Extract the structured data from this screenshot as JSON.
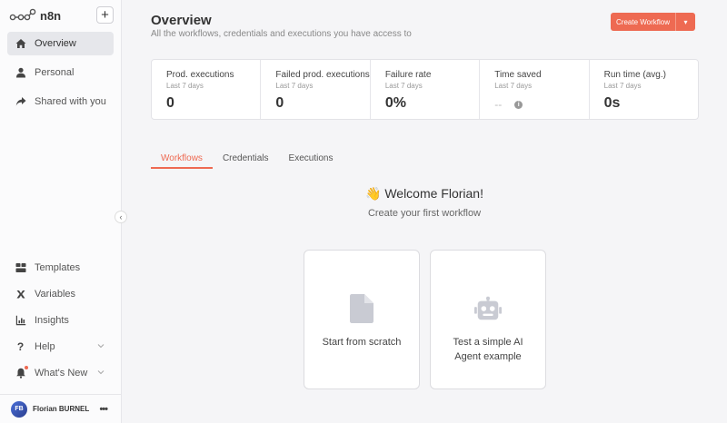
{
  "app": {
    "name": "n8n"
  },
  "sidebar": {
    "add_label": "+",
    "items": [
      {
        "label": "Overview",
        "icon": "home-icon"
      },
      {
        "label": "Personal",
        "icon": "user-icon"
      },
      {
        "label": "Shared with you",
        "icon": "share-icon"
      }
    ],
    "bottom_items": [
      {
        "label": "Templates",
        "icon": "templates-icon"
      },
      {
        "label": "Variables",
        "icon": "variables-icon"
      },
      {
        "label": "Insights",
        "icon": "insights-icon"
      },
      {
        "label": "Help",
        "icon": "help-icon"
      },
      {
        "label": "What's New",
        "icon": "bell-icon"
      }
    ],
    "user": {
      "initials": "FB",
      "name": "Florian BURNEL",
      "menu": "•••"
    },
    "collapse": "‹"
  },
  "header": {
    "title": "Overview",
    "subtitle": "All the workflows, credentials and executions you have access to",
    "create_label": "Create Workflow",
    "create_caret": "▾"
  },
  "stats": [
    {
      "label": "Prod. executions",
      "period": "Last 7 days",
      "value": "0"
    },
    {
      "label": "Failed prod. executions",
      "period": "Last 7 days",
      "value": "0"
    },
    {
      "label": "Failure rate",
      "period": "Last 7 days",
      "value": "0%"
    },
    {
      "label": "Time saved",
      "period": "Last 7 days",
      "value": "--"
    },
    {
      "label": "Run time (avg.)",
      "period": "Last 7 days",
      "value": "0s"
    }
  ],
  "tabs": [
    "Workflows",
    "Credentials",
    "Executions"
  ],
  "welcome": {
    "title": "👋 Welcome Florian!",
    "subtitle": "Create your first workflow"
  },
  "cards": [
    {
      "label": "Start from scratch",
      "icon": "file-icon"
    },
    {
      "label": "Test a simple AI Agent example",
      "icon": "robot-icon"
    }
  ],
  "colors": {
    "accent": "#ee6a52"
  }
}
